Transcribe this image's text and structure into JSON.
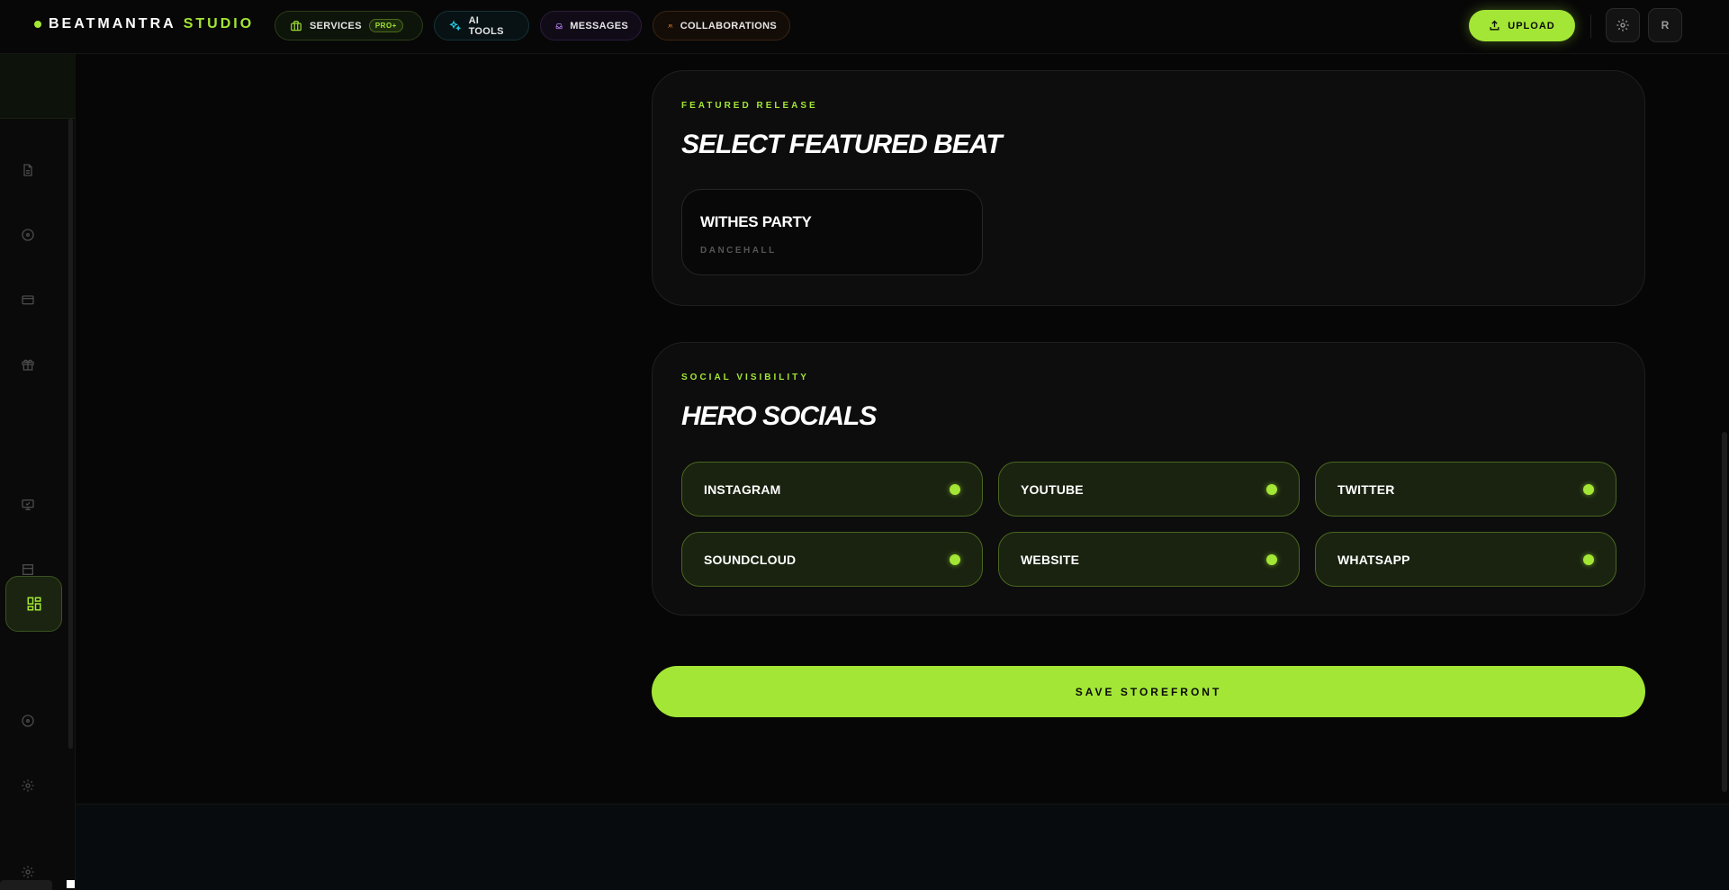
{
  "brand": {
    "name": "BEATMANTRA",
    "suffix": "STUDIO"
  },
  "nav": {
    "services": {
      "label": "SERVICES",
      "badge": "PRO+"
    },
    "ai_tools": {
      "label": "AI TOOLS"
    },
    "messages": {
      "label": "MESSAGES"
    },
    "collaborations": {
      "label": "COLLABORATIONS"
    }
  },
  "header": {
    "upload_label": "UPLOAD",
    "avatar_initial": "R"
  },
  "featured": {
    "eyebrow": "FEATURED RELEASE",
    "title": "SELECT FEATURED BEAT",
    "beat": {
      "name": "WITHES PARTY",
      "genre": "DANCEHALL"
    }
  },
  "social": {
    "eyebrow": "SOCIAL VISIBILITY",
    "title": "HERO SOCIALS",
    "items": [
      {
        "label": "INSTAGRAM",
        "enabled": true
      },
      {
        "label": "YOUTUBE",
        "enabled": true
      },
      {
        "label": "TWITTER",
        "enabled": true
      },
      {
        "label": "SOUNDCLOUD",
        "enabled": true
      },
      {
        "label": "WEBSITE",
        "enabled": true
      },
      {
        "label": "WHATSAPP",
        "enabled": true
      }
    ]
  },
  "save_label": "SAVE STOREFRONT",
  "colors": {
    "accent": "#a3e635",
    "background": "#060606",
    "card": "#0d0d0d"
  },
  "sidebar": {
    "icons": [
      "file-icon",
      "disc-icon",
      "card-icon",
      "gift-icon",
      "monitor-icon",
      "archive-icon",
      "dashboard-icon",
      "disc-icon",
      "gear-icon",
      "gear-icon"
    ],
    "active": "dashboard-icon"
  }
}
